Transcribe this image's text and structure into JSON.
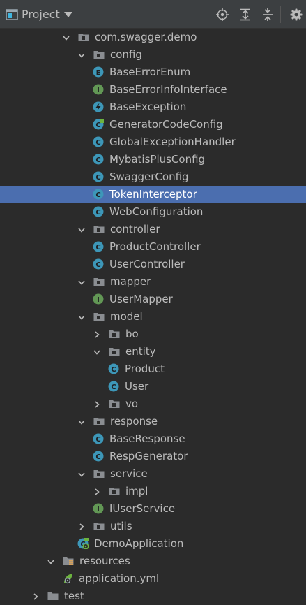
{
  "toolbar": {
    "title": "Project",
    "icons": [
      "locate-icon",
      "expand-all-icon",
      "collapse-all-icon",
      "settings-icon"
    ]
  },
  "tree": [
    {
      "depth": 2,
      "expanded": true,
      "icon": "package-folder",
      "label": "com.swagger.demo"
    },
    {
      "depth": 3,
      "expanded": true,
      "icon": "package-folder",
      "label": "config"
    },
    {
      "depth": 4,
      "icon": "enum",
      "label": "BaseErrorEnum"
    },
    {
      "depth": 4,
      "icon": "interface",
      "label": "BaseErrorInfoInterface"
    },
    {
      "depth": 4,
      "icon": "exception",
      "label": "BaseException"
    },
    {
      "depth": 4,
      "icon": "config-class",
      "label": "GeneratorCodeConfig"
    },
    {
      "depth": 4,
      "icon": "class",
      "label": "GlobalExceptionHandler"
    },
    {
      "depth": 4,
      "icon": "class",
      "label": "MybatisPlusConfig"
    },
    {
      "depth": 4,
      "icon": "class",
      "label": "SwaggerConfig"
    },
    {
      "depth": 4,
      "icon": "class",
      "label": "TokenInterceptor",
      "selected": true
    },
    {
      "depth": 4,
      "icon": "class",
      "label": "WebConfiguration"
    },
    {
      "depth": 3,
      "expanded": true,
      "icon": "package-folder",
      "label": "controller"
    },
    {
      "depth": 4,
      "icon": "class",
      "label": "ProductController"
    },
    {
      "depth": 4,
      "icon": "class",
      "label": "UserController"
    },
    {
      "depth": 3,
      "expanded": true,
      "icon": "package-folder",
      "label": "mapper"
    },
    {
      "depth": 4,
      "icon": "interface",
      "label": "UserMapper"
    },
    {
      "depth": 3,
      "expanded": true,
      "icon": "package-folder",
      "label": "model"
    },
    {
      "depth": 4,
      "expanded": false,
      "icon": "package-folder",
      "label": "bo"
    },
    {
      "depth": 4,
      "expanded": true,
      "icon": "package-folder",
      "label": "entity"
    },
    {
      "depth": 5,
      "icon": "class",
      "label": "Product"
    },
    {
      "depth": 5,
      "icon": "class",
      "label": "User"
    },
    {
      "depth": 4,
      "expanded": false,
      "icon": "package-folder",
      "label": "vo"
    },
    {
      "depth": 3,
      "expanded": true,
      "icon": "package-folder",
      "label": "response"
    },
    {
      "depth": 4,
      "icon": "class",
      "label": "BaseResponse"
    },
    {
      "depth": 4,
      "icon": "class",
      "label": "RespGenerator"
    },
    {
      "depth": 3,
      "expanded": true,
      "icon": "package-folder",
      "label": "service"
    },
    {
      "depth": 4,
      "expanded": false,
      "icon": "package-folder",
      "label": "impl"
    },
    {
      "depth": 4,
      "icon": "interface",
      "label": "IUserService"
    },
    {
      "depth": 3,
      "expanded": false,
      "icon": "package-folder",
      "label": "utils"
    },
    {
      "depth": 3,
      "icon": "spring-boot-app",
      "label": "DemoApplication"
    },
    {
      "depth": 1,
      "expanded": true,
      "icon": "resources-folder",
      "label": "resources"
    },
    {
      "depth": 2,
      "icon": "yaml-file",
      "label": "application.yml"
    },
    {
      "depth": 0,
      "expanded": false,
      "icon": "folder",
      "label": "test"
    }
  ],
  "colors": {
    "background": "#2b2b2b",
    "toolbar": "#3c3f41",
    "selection": "#4b6eaf",
    "text": "#bbbbbb",
    "class": "#3d97b8",
    "interface": "#629755",
    "enum": "#3d97b8",
    "folder": "#8a8d91",
    "spring": "#6cb33f"
  }
}
